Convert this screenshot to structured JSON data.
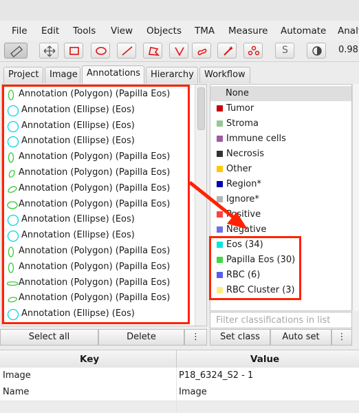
{
  "menu": [
    "File",
    "Edit",
    "Tools",
    "View",
    "Objects",
    "TMA",
    "Measure",
    "Automate",
    "Analy"
  ],
  "toolbar": {
    "tools": [
      "move-tool",
      "pan-tool",
      "rectangle-tool",
      "ellipse-tool",
      "line-tool",
      "polygon-tool",
      "polyline-tool",
      "brush-tool",
      "wand-tool",
      "points-tool"
    ],
    "s_label": "S",
    "opacity_value": "0.98"
  },
  "tabs": [
    "Project",
    "Image",
    "Annotations",
    "Hierarchy",
    "Workflow"
  ],
  "selected_tab": "Annotations",
  "annotations": [
    {
      "label": "Annotation (Polygon) (Papilla Eos)",
      "shape": "polygon"
    },
    {
      "label": "Annotation (Ellipse) (Eos)",
      "shape": "ellipse"
    },
    {
      "label": "Annotation (Ellipse) (Eos)",
      "shape": "ellipse"
    },
    {
      "label": "Annotation (Ellipse) (Eos)",
      "shape": "ellipse"
    },
    {
      "label": "Annotation (Polygon) (Papilla Eos)",
      "shape": "polygon"
    },
    {
      "label": "Annotation (Polygon) (Papilla Eos)",
      "shape": "polygon"
    },
    {
      "label": "Annotation (Polygon) (Papilla Eos)",
      "shape": "polygon"
    },
    {
      "label": "Annotation (Polygon) (Papilla Eos)",
      "shape": "polygon"
    },
    {
      "label": "Annotation (Ellipse) (Eos)",
      "shape": "ellipse"
    },
    {
      "label": "Annotation (Ellipse) (Eos)",
      "shape": "ellipse"
    },
    {
      "label": "Annotation (Polygon) (Papilla Eos)",
      "shape": "polygon"
    },
    {
      "label": "Annotation (Polygon) (Papilla Eos)",
      "shape": "polygon"
    },
    {
      "label": "Annotation (Polygon) (Papilla Eos)",
      "shape": "polygon"
    },
    {
      "label": "Annotation (Polygon) (Papilla Eos)",
      "shape": "polygon"
    },
    {
      "label": "Annotation (Ellipse) (Eos)",
      "shape": "ellipse"
    }
  ],
  "classes": [
    {
      "name": "None",
      "color": null
    },
    {
      "name": "Tumor",
      "color": "#c8000a"
    },
    {
      "name": "Stroma",
      "color": "#96c896"
    },
    {
      "name": "Immune cells",
      "color": "#a05aa0"
    },
    {
      "name": "Necrosis",
      "color": "#323232"
    },
    {
      "name": "Other",
      "color": "#ffc800"
    },
    {
      "name": "Region*",
      "color": "#0000b4"
    },
    {
      "name": "Ignore*",
      "color": "#b4b4b4"
    },
    {
      "name": "Positive",
      "color": "#ff4040"
    },
    {
      "name": "Negative",
      "color": "#7070e0"
    },
    {
      "name": "Eos (34)",
      "color": "#00e5e5"
    },
    {
      "name": "Papilla Eos (30)",
      "color": "#40d840"
    },
    {
      "name": "RBC (6)",
      "color": "#5a5ae8"
    },
    {
      "name": "RBC Cluster (3)",
      "color": "#ffeb80"
    }
  ],
  "filter_placeholder": "Filter classifications in list",
  "buttons": {
    "select_all": "Select all",
    "delete": "Delete",
    "more": "⋮",
    "set_class": "Set class",
    "auto_set": "Auto set"
  },
  "table": {
    "headers": [
      "Key",
      "Value"
    ],
    "rows": [
      {
        "key": "Image",
        "value": "P18_6324_S2 - 1"
      },
      {
        "key": "Name",
        "value": "Image"
      }
    ]
  },
  "colors": {
    "highlight": "#ff2200",
    "ellipse_stroke": "#00d5e5",
    "polygon_stroke": "#33cc33"
  }
}
